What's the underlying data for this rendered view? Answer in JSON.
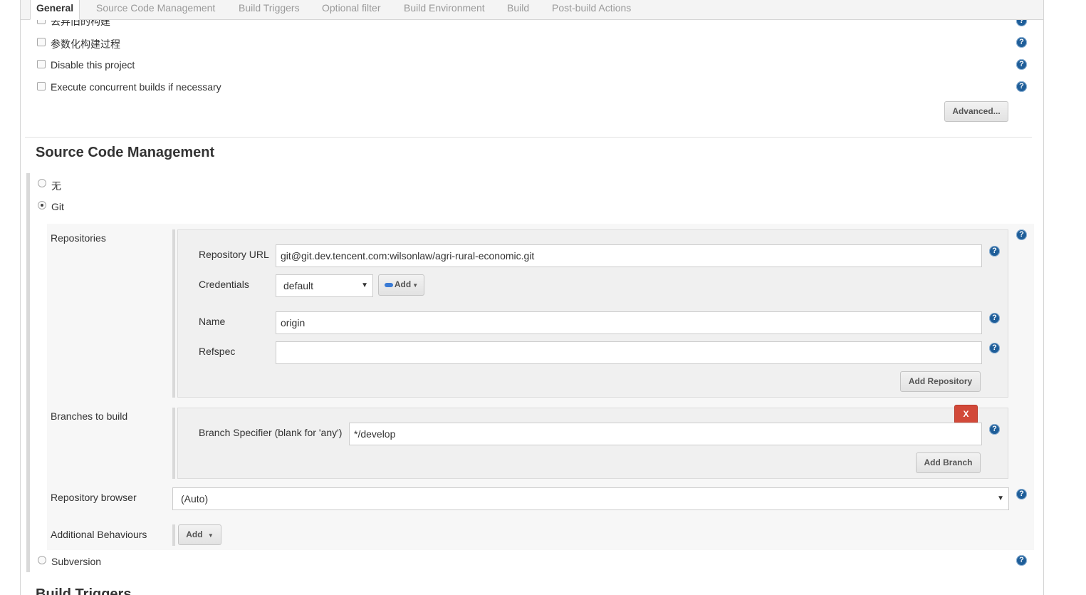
{
  "tabs": [
    "General",
    "Source Code Management",
    "Build Triggers",
    "Optional filter",
    "Build Environment",
    "Build",
    "Post-build Actions"
  ],
  "general": {
    "partial_option": "丢弃旧的构建",
    "options": [
      "参数化构建过程",
      "Disable this project",
      "Execute concurrent builds if necessary"
    ],
    "advanced_button": "Advanced..."
  },
  "scm": {
    "title": "Source Code Management",
    "radio_none": "无",
    "radio_git": "Git",
    "radio_svn": "Subversion",
    "repositories_label": "Repositories",
    "repo_url_label": "Repository URL",
    "repo_url_value": "git@git.dev.tencent.com:wilsonlaw/agri-rural-economic.git",
    "credentials_label": "Credentials",
    "credentials_value": "default",
    "add_credentials_label": "Add",
    "name_label": "Name",
    "name_value": "origin",
    "refspec_label": "Refspec",
    "refspec_value": "",
    "add_repository_button": "Add Repository",
    "branches_label": "Branches to build",
    "delete_branch_button": "X",
    "branch_specifier_label": "Branch Specifier (blank for 'any')",
    "branch_specifier_value": "*/develop",
    "add_branch_button": "Add Branch",
    "repo_browser_label": "Repository browser",
    "repo_browser_value": "(Auto)",
    "additional_behaviours_label": "Additional Behaviours",
    "add_behaviour_button": "Add"
  },
  "next_section_partial": "Build Triggers",
  "icons": {
    "help": "help-icon",
    "key": "key-icon",
    "dropdown": "caret-down-icon"
  },
  "colors": {
    "help_icon": "#1f5e99",
    "delete_button": "#d24939",
    "tab_inactive_text": "#999999"
  }
}
